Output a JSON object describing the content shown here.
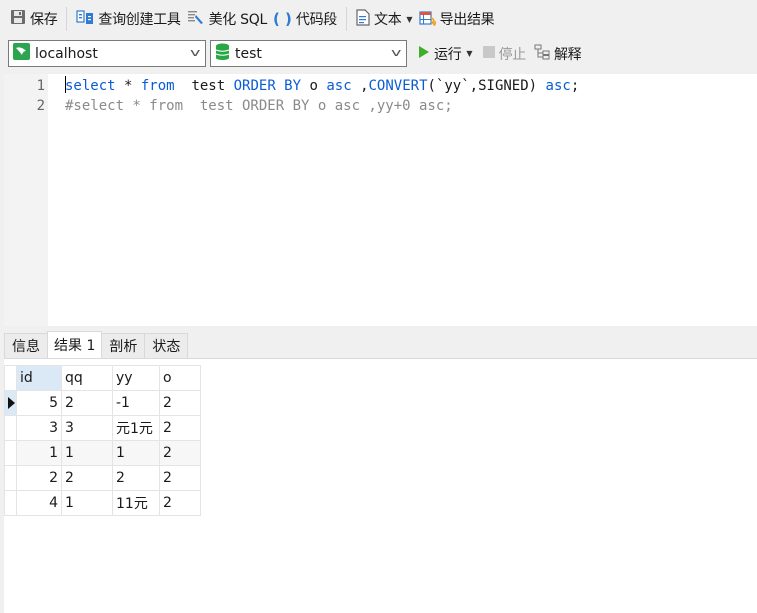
{
  "toolbar": {
    "save_label": "保存",
    "query_builder_label": "查询创建工具",
    "beautify_sql_label": "美化 SQL",
    "code_snippet_label": "代码段",
    "text_label": "文本",
    "export_label": "导出结果",
    "icons": {
      "save": "save-icon",
      "query_builder": "query-builder-icon",
      "beautify": "beautify-icon",
      "snippet": "code-snippet-icon",
      "text": "text-document-icon",
      "export": "export-results-icon"
    }
  },
  "connection": {
    "value": "localhost",
    "icon": "mysql-connection-icon"
  },
  "database": {
    "value": "test",
    "icon": "database-icon"
  },
  "run": {
    "run_label": "运行",
    "stop_label": "停止",
    "explain_label": "解释"
  },
  "editor": {
    "lines": [
      {
        "number": "1",
        "tokens": [
          {
            "t": "select",
            "c": "kw"
          },
          {
            "t": " * ",
            "c": "pl"
          },
          {
            "t": "from",
            "c": "kw"
          },
          {
            "t": "  test ",
            "c": "pl"
          },
          {
            "t": "ORDER BY",
            "c": "kw"
          },
          {
            "t": " o ",
            "c": "pl"
          },
          {
            "t": "asc",
            "c": "kw"
          },
          {
            "t": " ,",
            "c": "pl"
          },
          {
            "t": "CONVERT",
            "c": "kw"
          },
          {
            "t": "(`yy`,SIGNED) ",
            "c": "pl"
          },
          {
            "t": "asc",
            "c": "kw"
          },
          {
            "t": ";",
            "c": "pl"
          }
        ]
      },
      {
        "number": "2",
        "tokens": [
          {
            "t": "#select * from  test ORDER BY o asc ,yy+0 asc;",
            "c": "cm"
          }
        ]
      }
    ]
  },
  "result_tabs": [
    {
      "label": "信息",
      "active": false
    },
    {
      "label": "结果 1",
      "active": true
    },
    {
      "label": "剖析",
      "active": false
    },
    {
      "label": "状态",
      "active": false
    }
  ],
  "grid": {
    "columns": [
      "id",
      "qq",
      "yy",
      "o"
    ],
    "rows": [
      [
        "5",
        "2",
        "-1",
        "2"
      ],
      [
        "3",
        "3",
        "元1元",
        "2"
      ],
      [
        "1",
        "1",
        "1",
        "2"
      ],
      [
        "2",
        "2",
        "2",
        "2"
      ],
      [
        "4",
        "1",
        "11元",
        "2"
      ]
    ],
    "current_row": 0
  }
}
